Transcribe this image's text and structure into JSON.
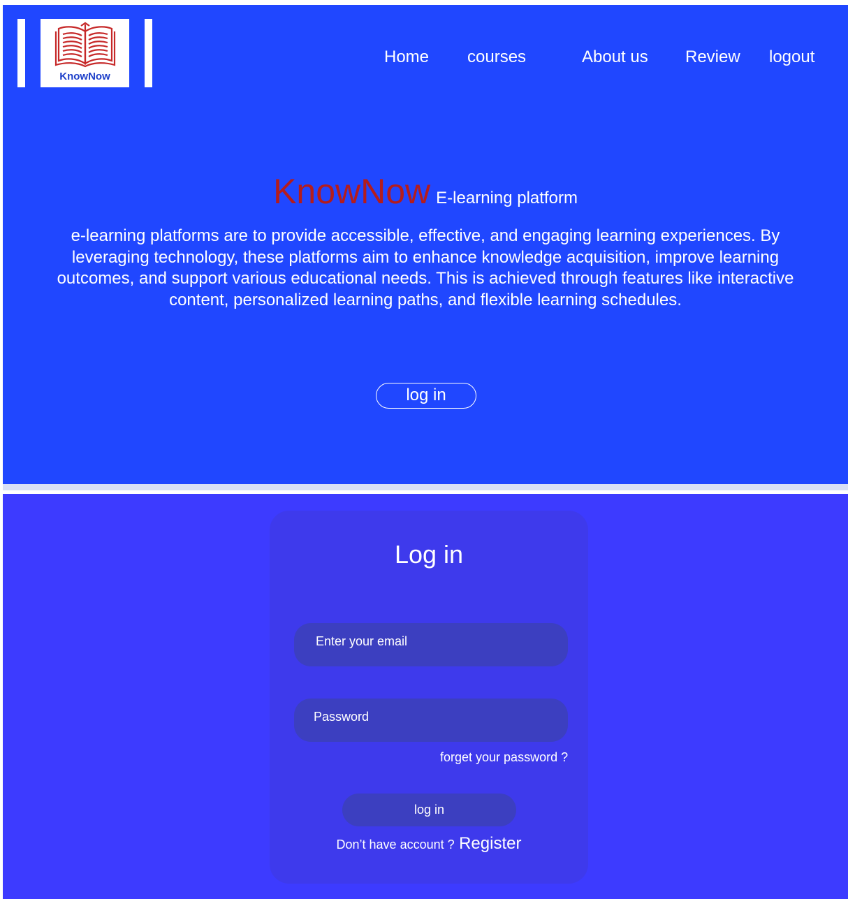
{
  "logo": {
    "text": "KnowNow",
    "icon": "open-book-icon",
    "colors": {
      "book": "#c62828",
      "text": "#1d3fc9"
    }
  },
  "nav": {
    "items": [
      {
        "label": "Home"
      },
      {
        "label": "courses"
      },
      {
        "label": "About us"
      },
      {
        "label": "Review"
      },
      {
        "label": "logout"
      }
    ]
  },
  "hero": {
    "brand": "KnowNow",
    "tagline": "E-learning platform",
    "description": "e-learning platforms are to provide accessible, effective, and engaging learning experiences. By leveraging technology, these platforms aim to enhance knowledge acquisition, improve learning outcomes, and support various educational needs. This is achieved through features like interactive content, personalized learning paths, and flexible learning schedules.",
    "button_label": "log in"
  },
  "login_form": {
    "title": "Log in",
    "email_placeholder": "Enter your email",
    "password_placeholder": "Password",
    "forgot_label": "forget your password ?",
    "submit_label": "log in",
    "register_prompt": "Don’t have account ?",
    "register_label": "Register"
  },
  "colors": {
    "hero_bg": "#2047ff",
    "section_bg": "#3d3bff",
    "card_bg": "#3e3aec",
    "field_bg": "#3c3fc0",
    "brand_red": "#b41c1c",
    "divider": "#d9e0f5"
  }
}
